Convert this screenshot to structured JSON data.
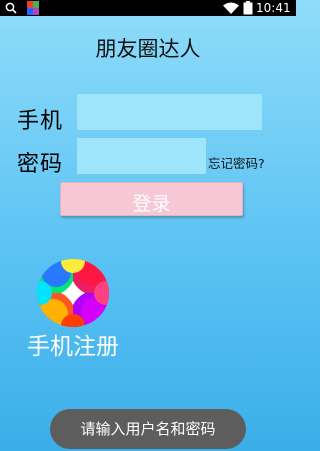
{
  "status_bar": {
    "time": "10:41",
    "icons": [
      "search-icon",
      "app-icon",
      "wifi-icon",
      "battery-icon"
    ]
  },
  "app_title": "朋友圈达人",
  "login_form": {
    "phone_label": "手机",
    "phone_value": "",
    "password_label": "密码",
    "password_value": "",
    "forgot_password_label": "忘记密码?",
    "login_button_label": "登录"
  },
  "register": {
    "icon": "colorful-wheel-icon",
    "label": "手机注册"
  },
  "toast": {
    "message": "请输入用户名和密码"
  },
  "colors": {
    "background_top": "#8fdcf9",
    "background_bottom": "#3aaee8",
    "input_fill": "#9ee4fb",
    "login_button": "#f6c7d4",
    "toast_bg": "#5d5d5d"
  }
}
